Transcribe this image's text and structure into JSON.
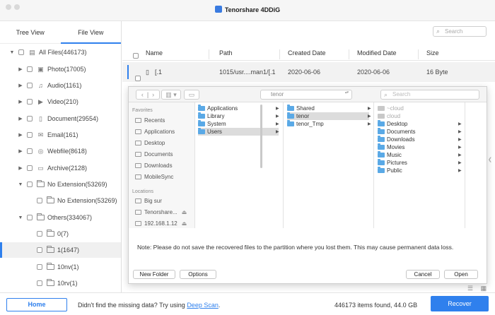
{
  "window": {
    "title": "Tenorshare 4DDiG"
  },
  "sidebar": {
    "tabs": [
      {
        "label": "Tree View"
      },
      {
        "label": "File View"
      }
    ],
    "tree": [
      {
        "label": "All Files(446173)",
        "icon": "drive-icon",
        "expanded": true
      },
      {
        "label": "Photo(17005)",
        "icon": "photo-icon",
        "expanded": false
      },
      {
        "label": "Audio(1161)",
        "icon": "audio-icon",
        "expanded": false
      },
      {
        "label": "Video(210)",
        "icon": "video-icon",
        "expanded": false
      },
      {
        "label": "Document(29554)",
        "icon": "document-icon",
        "expanded": false
      },
      {
        "label": "Email(161)",
        "icon": "email-icon",
        "expanded": false
      },
      {
        "label": "Webfile(8618)",
        "icon": "web-icon",
        "expanded": false
      },
      {
        "label": "Archive(2128)",
        "icon": "archive-icon",
        "expanded": false
      },
      {
        "label": "No Extension(53269)",
        "icon": "folder-icon",
        "expanded": true
      },
      {
        "label": "No Extension(53269)",
        "icon": "folder-icon"
      },
      {
        "label": "Others(334067)",
        "icon": "folder-icon",
        "expanded": true
      },
      {
        "label": "0(7)",
        "icon": "folder-icon"
      },
      {
        "label": "1(1647)",
        "icon": "folder-icon",
        "selected": true
      },
      {
        "label": "10nv(1)",
        "icon": "folder-icon"
      },
      {
        "label": "10rv(1)",
        "icon": "folder-icon"
      }
    ]
  },
  "main": {
    "search_placeholder": "Search",
    "columns": {
      "name": "Name",
      "path": "Path",
      "created": "Created Date",
      "modified": "Modified Date",
      "size": "Size"
    },
    "rows": [
      {
        "name": "[.1",
        "path": "1015/usr....man1/[.1",
        "created": "2020-06-06",
        "modified": "2020-06-06",
        "size": "16 Byte"
      }
    ]
  },
  "dialog": {
    "location": "tenor",
    "search_placeholder": "Search",
    "sidebar": {
      "favorites_label": "Favorites",
      "favorites": [
        "Recents",
        "Applications",
        "Desktop",
        "Documents",
        "Downloads",
        "MobileSync"
      ],
      "locations_label": "Locations",
      "locations": [
        "Big sur",
        "Tenorshare...",
        "192.168.1.12"
      ]
    },
    "column1": [
      "Applications",
      "Library",
      "System",
      "Users"
    ],
    "column2": [
      "Shared",
      "tenor",
      "tenor_Tmp"
    ],
    "column3": [
      "~cloud",
      "cloud",
      "Desktop",
      "Documents",
      "Downloads",
      "Movies",
      "Music",
      "Pictures",
      "Public"
    ],
    "note": "Note: Please do not save the recovered files to the partition where you lost them. This may cause permanent data loss.",
    "new_folder_label": "New Folder",
    "options_label": "Options",
    "cancel_label": "Cancel",
    "open_label": "Open"
  },
  "footer": {
    "home_label": "Home",
    "missing_text": "Didn't find the missing data? Try using",
    "deep_scan_label": "Deep Scan",
    "deep_scan_suffix": ".",
    "found_text": "446173 items found, 44.0 GB",
    "recover_label": "Recover"
  },
  "colors": {
    "accent": "#2f80ed",
    "folder": "#5aa9e6"
  }
}
